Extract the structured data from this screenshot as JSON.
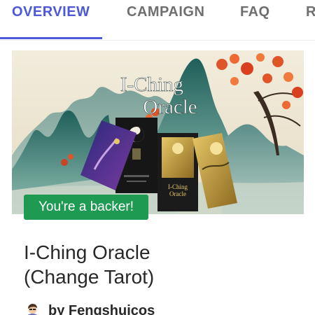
{
  "tabs": [
    {
      "label": "OVERVIEW",
      "active": true
    },
    {
      "label": "CAMPAIGN",
      "active": false
    },
    {
      "label": "FAQ",
      "active": false
    },
    {
      "label": "R",
      "active": false
    }
  ],
  "hero": {
    "title_line1": "I-Ching",
    "title_line2": "Oracle",
    "box_label_line1": "I-Ching",
    "box_label_line2": "Oracle"
  },
  "badge": {
    "label": "You're a backer!"
  },
  "project": {
    "title_line1": "I-Ching Oracle",
    "title_line2": "(Change Tarot)"
  },
  "creator": {
    "label": "by Fengshuicos",
    "avatar_icon": "person-avatar-icon"
  },
  "colors": {
    "accent": "#4b58d8",
    "badge": "#1e9a52",
    "text": "#282828"
  }
}
